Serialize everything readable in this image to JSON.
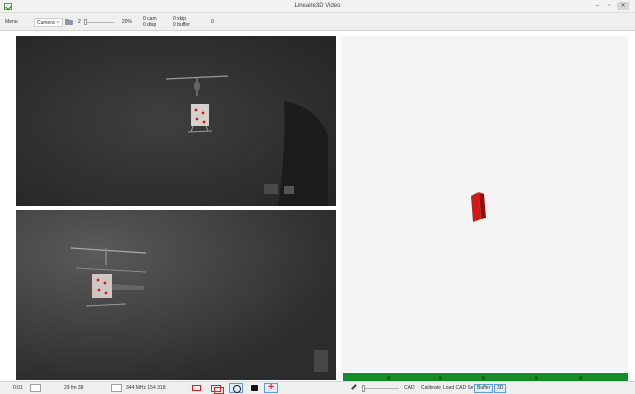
{
  "window": {
    "title": "Lineaire3D Video",
    "controls": {
      "minimize": "–",
      "maximize": "▫",
      "close": "✕"
    }
  },
  "toolbar": {
    "menu_label": "Menu",
    "camera_tab_label": "Camera",
    "camera_tab_close": "×",
    "frame_value": "2",
    "zoom_percent": "20%",
    "stat_cam": "0 cam",
    "stat_disp": "0 disp",
    "stat_skip": "0 skip",
    "stat_buffer": "0 buffer",
    "counter": "0"
  },
  "statusbar": {
    "time": "0:01",
    "fps_line": "29  fm  38",
    "mhz_line": "344 MHz  154   318",
    "cad_label": "CAD",
    "calibrate_label": "Calibrate",
    "load_cad_set_label": "Load CAD Set",
    "buffer_label": "Buffer",
    "mode_label": "3D"
  },
  "icons": {
    "app": "app-icon",
    "folder": "folder-icon",
    "rectangle": "rectangle-icon",
    "stack": "stacked-rectangles-icon",
    "circle": "circle-target-icon",
    "camera": "camera-icon",
    "crosshair": "crosshair-icon",
    "pen": "pen-icon"
  },
  "colors": {
    "accent_red": "#e02020",
    "progress_green": "#178a2c",
    "cube_red": "#d11b1b"
  }
}
